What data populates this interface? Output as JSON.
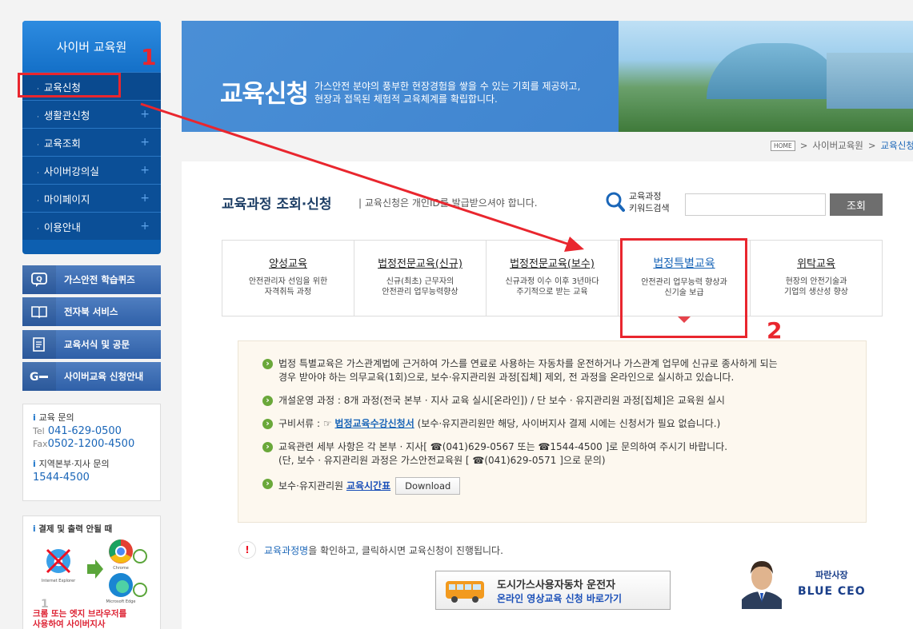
{
  "sidebar": {
    "title": "사이버 교육원",
    "items": [
      {
        "label": "교육신청"
      },
      {
        "label": "생활관신청"
      },
      {
        "label": "교육조회"
      },
      {
        "label": "사이버강의실"
      },
      {
        "label": "마이페이지"
      },
      {
        "label": "이용안내"
      }
    ],
    "quick_links": [
      {
        "label": "가스안전 학습퀴즈",
        "icon": "quiz-icon"
      },
      {
        "label": "전자북 서비스",
        "icon": "book-icon"
      },
      {
        "label": "교육서식 및 공문",
        "icon": "document-icon"
      },
      {
        "label": "사이버교육 신청안내",
        "icon": "guide-icon"
      }
    ],
    "contact": {
      "edu_label": "교육 문의",
      "tel_prefix": "Tel",
      "tel": "041-629-0500",
      "fax_prefix": "Fax",
      "fax": "0502-1200-4500",
      "branch_label": "지역본부·지사 문의",
      "branch_tel": "1544-4500"
    },
    "browser": {
      "heading": "결제 및 출력 안될 때",
      "ie_label": "Internet Explorer",
      "chrome_label": "Chrome",
      "edge_label": "Microsoft Edge",
      "step": "1",
      "footer_line1": "크롬 또는 엣지 브라우저를",
      "footer_line2": "사용하여 사이버지사"
    }
  },
  "banner": {
    "title": "교육신청",
    "desc_line1": "가스안전 분야의 풍부한 현장경험을 쌓을 수 있는 기회를 제공하고,",
    "desc_line2": "현장과 접목된 체험적 교육체계를 확립합니다."
  },
  "breadcrumb": {
    "home": "HOME",
    "sep": ">",
    "level1": "사이버교육원",
    "current": "교육신청"
  },
  "main": {
    "heading": "교육과정 조회·신청",
    "subheading": "| 교육신청은 개인ID를 발급받으셔야 합니다.",
    "search": {
      "label_line1": "교육과정",
      "label_line2": "키워드검색",
      "value": "",
      "button": "조회"
    },
    "tabs": [
      {
        "title": "양성교육",
        "desc1": "안전관리자 선임을 위한",
        "desc2": "자격취득 과정"
      },
      {
        "title": "법정전문교육(신규)",
        "desc1": "신규(최초) 근무자의",
        "desc2": "안전관리 업무능력향상"
      },
      {
        "title": "법정전문교육(보수)",
        "desc1": "신규과정 이수 이후 3년마다",
        "desc2": "주기적으로 받는 교육"
      },
      {
        "title": "법정특별교육",
        "desc1": "안전관리 업무능력 향상과",
        "desc2": "신기술 보급"
      },
      {
        "title": "위탁교육",
        "desc1": "현장의 안전기술과",
        "desc2": "기업의 생산성 향상"
      }
    ],
    "notice": {
      "item1_line1": "법정 특별교육은 가스관계법에 근거하여 가스를 연료로 사용하는 자동차를 운전하거나 가스관계 업무에 신규로 종사하게 되는",
      "item1_line2": "경우 받아야 하는 의무교육(1회)으로, 보수·유지관리원 과정[집체] 제외, 전 과정을 온라인으로 실시하고 있습니다.",
      "item2": "개설운영 과정 : 8개 과정(전국 본부 · 지사 교육 실시[온라인]) / 단 보수 · 유지관리원 과정[집체]은 교육원 실시",
      "item3_prefix": "구비서류 : ☞ ",
      "item3_link": "법정교육수강신청서",
      "item3_suffix": " (보수·유지관리원만 해당, 사이버지사 결제 시에는 신청서가 필요 없습니다.)",
      "item4_line1": "교육관련 세부 사항은 각 본부 · 지사[ ☎(041)629-0567 또는 ☎1544-4500 ]로 문의하여 주시기 바랍니다.",
      "item4_line2": "(단, 보수 · 유지관리원 과정은 가스안전교육원 [ ☎(041)629-0571 ]으로 문의)",
      "item5_prefix": "보수·유지관리원 ",
      "item5_link": "교육시간표",
      "download_label": "Download"
    },
    "alert": {
      "mark": "!",
      "highlight": "교육과정명",
      "text": "을 확인하고, 클릭하시면 교육신청이 진행됩니다."
    },
    "bus_button": {
      "line1": "도시가스사용자동차 운전자",
      "line2": "온라인 영상교육 신청 바로가기"
    },
    "ceo": {
      "kr": "파란사장",
      "en": "BLUE CEO"
    }
  },
  "annotations": {
    "num1": "1",
    "num2": "2",
    "color": "#e9262e"
  },
  "colors": {
    "primary": "#0d5fb0",
    "accent_link": "#1a66b8",
    "notice_bg": "#fdf8ef",
    "annotation_red": "#e9262e"
  }
}
